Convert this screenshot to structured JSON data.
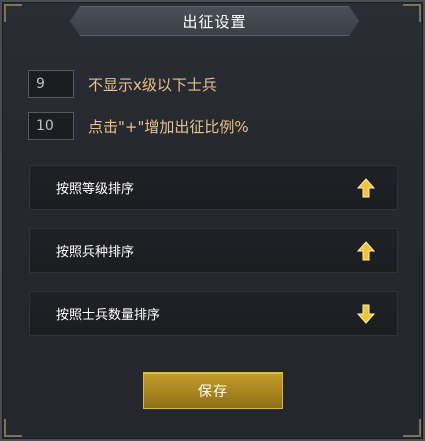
{
  "dialog": {
    "title": "出征设置"
  },
  "settings": [
    {
      "value": "9",
      "label": "不显示x级以下士兵"
    },
    {
      "value": "10",
      "label": "点击\"+\"增加出征比例%"
    }
  ],
  "sort_options": [
    {
      "label": "按照等级排序",
      "arrow": "up",
      "arrow_icon": "arrow-up-icon"
    },
    {
      "label": "按照兵种排序",
      "arrow": "up",
      "arrow_icon": "arrow-up-icon"
    },
    {
      "label": "按照士兵数量排序",
      "arrow": "down",
      "arrow_icon": "arrow-down-icon"
    }
  ],
  "save_button": {
    "label": "保存"
  },
  "colors": {
    "accent_gold": "#e9c08a",
    "button_gold": "#c29b2a",
    "arrow_gold": "#f2c23a"
  }
}
